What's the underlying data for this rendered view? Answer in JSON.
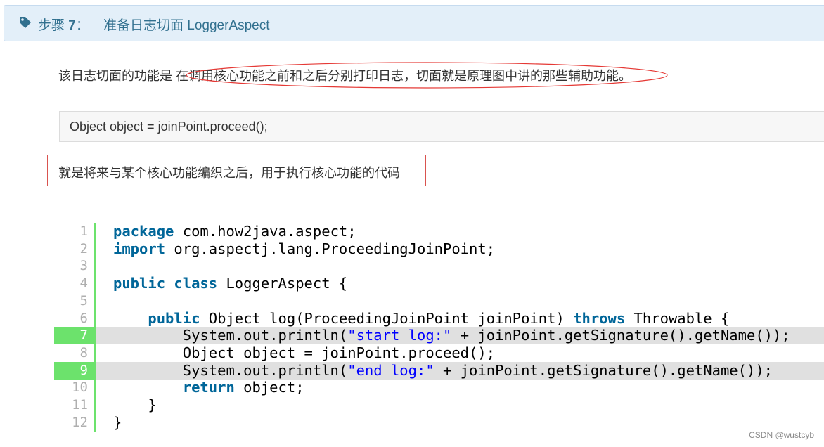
{
  "header": {
    "step_label": "步骤",
    "step_number": "7",
    "step_colon": "：",
    "title": "准备日志切面 LoggerAspect",
    "icon": "tag-icon",
    "bg_color": "#e3eff9",
    "text_color": "#31708f"
  },
  "description": "该日志切面的功能是 在调用核心功能之前和之后分别打印日志，切面就是原理图中讲的那些辅助功能。",
  "code_highlight": "Object object = joinPoint.proceed();",
  "note": "就是将来与某个核心功能编织之后，用于执行核心功能的代码",
  "code": {
    "highlight_color": "#6ce26c",
    "keyword_color": "#006699",
    "string_color": "#0000ff",
    "highlighted_lines": [
      7,
      9
    ],
    "lines": [
      {
        "n": "1",
        "tokens": [
          {
            "t": "package",
            "k": "kw"
          },
          {
            "t": " com.how2java.aspect;"
          }
        ]
      },
      {
        "n": "2",
        "tokens": [
          {
            "t": "import",
            "k": "kw"
          },
          {
            "t": " org.aspectj.lang.ProceedingJoinPoint;"
          }
        ]
      },
      {
        "n": "3",
        "tokens": []
      },
      {
        "n": "4",
        "tokens": [
          {
            "t": "public",
            "k": "kw"
          },
          {
            "t": " "
          },
          {
            "t": "class",
            "k": "kw"
          },
          {
            "t": " LoggerAspect {"
          }
        ]
      },
      {
        "n": "5",
        "tokens": []
      },
      {
        "n": "6",
        "tokens": [
          {
            "t": "    "
          },
          {
            "t": "public",
            "k": "kw"
          },
          {
            "t": " Object log(ProceedingJoinPoint joinPoint) "
          },
          {
            "t": "throws",
            "k": "kw"
          },
          {
            "t": " Throwable {"
          }
        ]
      },
      {
        "n": "7",
        "tokens": [
          {
            "t": "        System.out.println("
          },
          {
            "t": "\"start log:\"",
            "k": "str"
          },
          {
            "t": " + joinPoint.getSignature().getName());"
          }
        ]
      },
      {
        "n": "8",
        "tokens": [
          {
            "t": "        Object object = joinPoint.proceed();"
          }
        ]
      },
      {
        "n": "9",
        "tokens": [
          {
            "t": "        System.out.println("
          },
          {
            "t": "\"end log:\"",
            "k": "str"
          },
          {
            "t": " + joinPoint.getSignature().getName());"
          }
        ]
      },
      {
        "n": "10",
        "tokens": [
          {
            "t": "        "
          },
          {
            "t": "return",
            "k": "kw"
          },
          {
            "t": " object;"
          }
        ]
      },
      {
        "n": "11",
        "tokens": [
          {
            "t": "    }"
          }
        ]
      },
      {
        "n": "12",
        "tokens": [
          {
            "t": "}"
          }
        ]
      }
    ]
  },
  "watermark": "CSDN @wustcyb"
}
